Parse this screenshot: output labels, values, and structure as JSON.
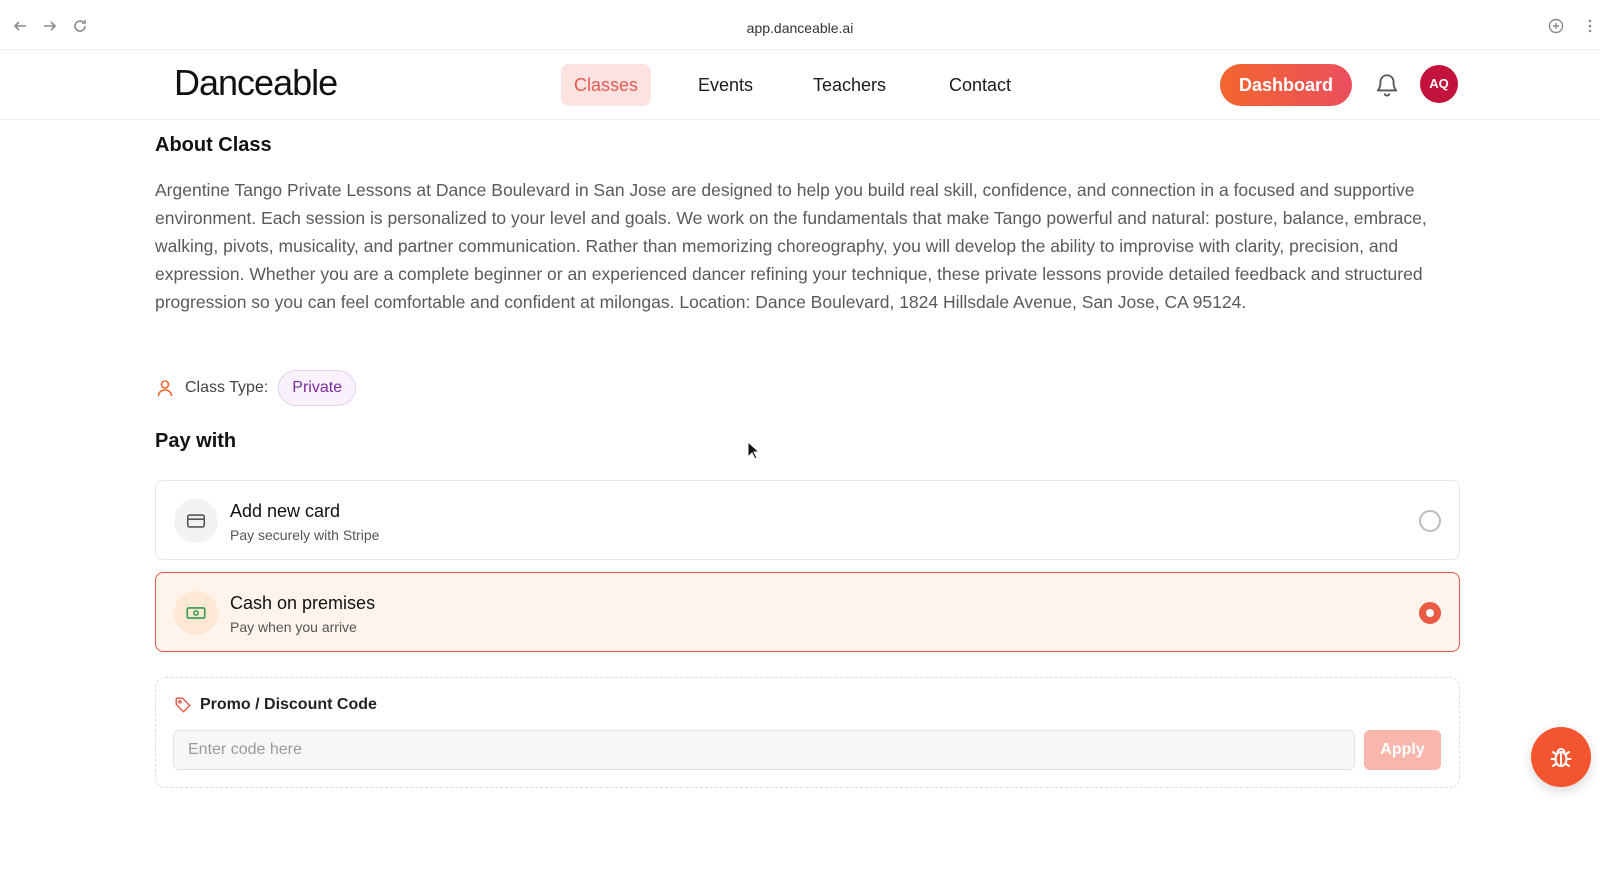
{
  "browser": {
    "url": "app.danceable.ai"
  },
  "header": {
    "logo_text": "Danceable",
    "nav": [
      {
        "label": "Classes",
        "active": true
      },
      {
        "label": "Events",
        "active": false
      },
      {
        "label": "Teachers",
        "active": false
      },
      {
        "label": "Contact",
        "active": false
      }
    ],
    "dashboard_label": "Dashboard",
    "avatar_initials": "AQ"
  },
  "about": {
    "heading": "About Class",
    "description": "Argentine Tango Private Lessons at Dance Boulevard in San Jose are designed to help you build real skill, confidence, and connection in a focused and supportive environment. Each session is personalized to your level and goals. We work on the fundamentals that make Tango powerful and natural: posture, balance, embrace, walking, pivots, musicality, and partner communication. Rather than memorizing choreography, you will develop the ability to improvise with clarity, precision, and expression. Whether you are a complete beginner or an experienced dancer refining your technique, these private lessons provide detailed feedback and structured progression so you can feel comfortable and confident at milongas. Location: Dance Boulevard, 1824 Hillsdale Avenue, San Jose, CA 95124.",
    "class_type_label": "Class Type:",
    "class_type_value": "Private"
  },
  "payment": {
    "heading": "Pay with",
    "options": [
      {
        "title": "Add new card",
        "subtitle": "Pay securely with Stripe",
        "icon": "credit-card-icon",
        "selected": false
      },
      {
        "title": "Cash on premises",
        "subtitle": "Pay when you arrive",
        "icon": "cash-icon",
        "selected": true
      }
    ]
  },
  "promo": {
    "title": "Promo / Discount Code",
    "placeholder": "Enter code here",
    "apply_label": "Apply"
  },
  "colors": {
    "accent": "#f2662e",
    "selected_border": "#e65a4d",
    "selected_bg": "#fff4ec",
    "avatar_bg": "#c3123b",
    "badge_text": "#7a2ea0"
  }
}
